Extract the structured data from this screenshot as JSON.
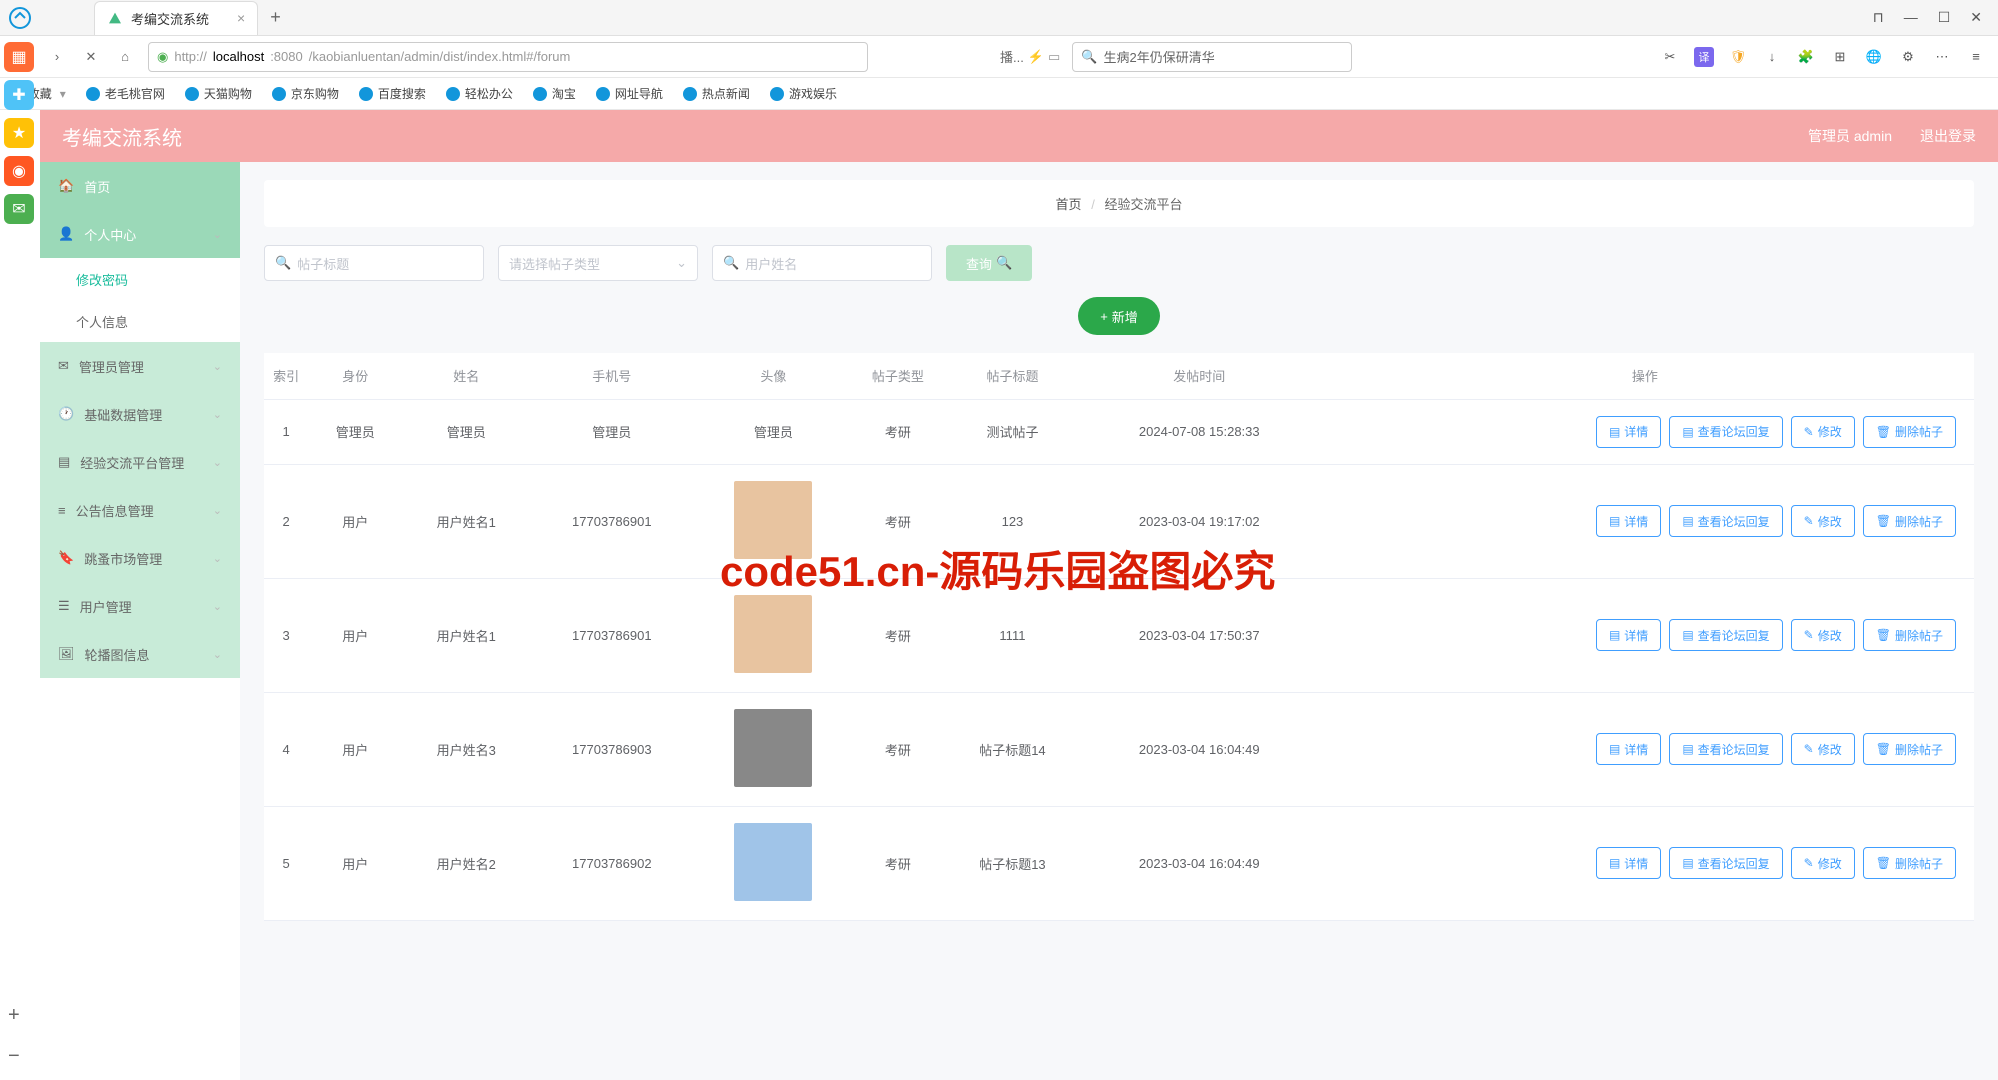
{
  "browser": {
    "tab_title": "考编交流系统",
    "url_host": "localhost",
    "url_port": ":8080",
    "url_path": "/kaobianluentan/admin/dist/index.html#/forum",
    "url_scheme": "http://",
    "speed_label": "播...",
    "search_text": "生病2年仍保研清华",
    "bookmarks_label": "收藏",
    "bookmarks": [
      "老毛桃官网",
      "天猫购物",
      "京东购物",
      "百度搜索",
      "轻松办公",
      "淘宝",
      "网址导航",
      "热点新闻",
      "游戏娱乐"
    ]
  },
  "app": {
    "title": "考编交流系统",
    "user_label": "管理员 admin",
    "logout": "退出登录"
  },
  "sidebar": {
    "home": "首页",
    "personal": "个人中心",
    "sub_pwd": "修改密码",
    "sub_info": "个人信息",
    "admin_mgmt": "管理员管理",
    "base_data": "基础数据管理",
    "exp_platform": "经验交流平台管理",
    "announce": "公告信息管理",
    "flea": "跳蚤市场管理",
    "user_mgmt": "用户管理",
    "carousel": "轮播图信息"
  },
  "breadcrumb": {
    "home": "首页",
    "current": "经验交流平台"
  },
  "filters": {
    "title_ph": "帖子标题",
    "type_ph": "请选择帖子类型",
    "user_ph": "用户姓名",
    "search": "查询",
    "add": "新增"
  },
  "columns": [
    "索引",
    "身份",
    "姓名",
    "手机号",
    "头像",
    "帖子类型",
    "帖子标题",
    "发帖时间",
    "操作"
  ],
  "actions": {
    "detail": "详情",
    "view_reply": "查看论坛回复",
    "edit": "修改",
    "delete": "删除帖子"
  },
  "rows": [
    {
      "idx": "1",
      "role": "管理员",
      "name": "管理员",
      "phone": "管理员",
      "avatar": "管理员",
      "type": "考研",
      "title": "测试帖子",
      "time": "2024-07-08 15:28:33",
      "noimg": true
    },
    {
      "idx": "2",
      "role": "用户",
      "name": "用户姓名1",
      "phone": "17703786901",
      "avatar": "",
      "type": "考研",
      "title": "123",
      "time": "2023-03-04 19:17:02"
    },
    {
      "idx": "3",
      "role": "用户",
      "name": "用户姓名1",
      "phone": "17703786901",
      "avatar": "",
      "type": "考研",
      "title": "1111",
      "time": "2023-03-04 17:50:37"
    },
    {
      "idx": "4",
      "role": "用户",
      "name": "用户姓名3",
      "phone": "17703786903",
      "avatar": "",
      "type": "考研",
      "title": "帖子标题14",
      "time": "2023-03-04 16:04:49"
    },
    {
      "idx": "5",
      "role": "用户",
      "name": "用户姓名2",
      "phone": "17703786902",
      "avatar": "",
      "type": "考研",
      "title": "帖子标题13",
      "time": "2023-03-04 16:04:49"
    }
  ],
  "watermark": "code51.cn",
  "big_watermark": "code51.cn-源码乐园盗图必究"
}
